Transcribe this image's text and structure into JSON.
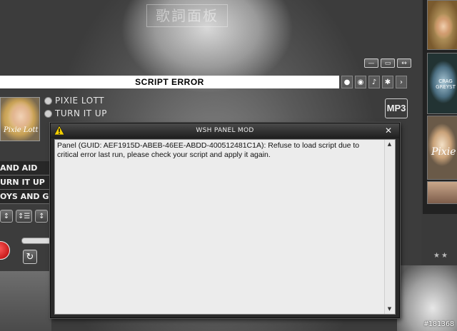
{
  "player": {
    "lyric_panel_title": "歌詞面板",
    "window_buttons": [
      "—",
      "▭",
      "↔"
    ],
    "error_bar_text": "SCRIPT ERROR",
    "bar_icons": [
      "person-icon",
      "disc-icon",
      "note-icon",
      "group-icon",
      "arrow-icon"
    ],
    "cover_text": "Pixie Lott",
    "artist": "PIXIE LOTT",
    "track": "TURN IT UP",
    "format_badge": "MP3",
    "playlist": [
      "AND AID",
      "URN IT UP",
      "OYS AND GI"
    ],
    "thumb_text_2": "CRAG GREYST",
    "thumb_text_3": "Pixie"
  },
  "dialog": {
    "title": "WSH PANEL MOD",
    "close_label": "✕",
    "message": "Panel (GUID: AEF1915D-ABEB-46EE-ABDD-400512481C1A): Refuse to load script due to critical error last run, please check your script and apply it again."
  },
  "watermark": "#181368",
  "colors": {
    "dialog_titlebar": "#2a2a2a",
    "dialog_text_bg": "#ececec",
    "warning_yellow": "#f5d000"
  }
}
